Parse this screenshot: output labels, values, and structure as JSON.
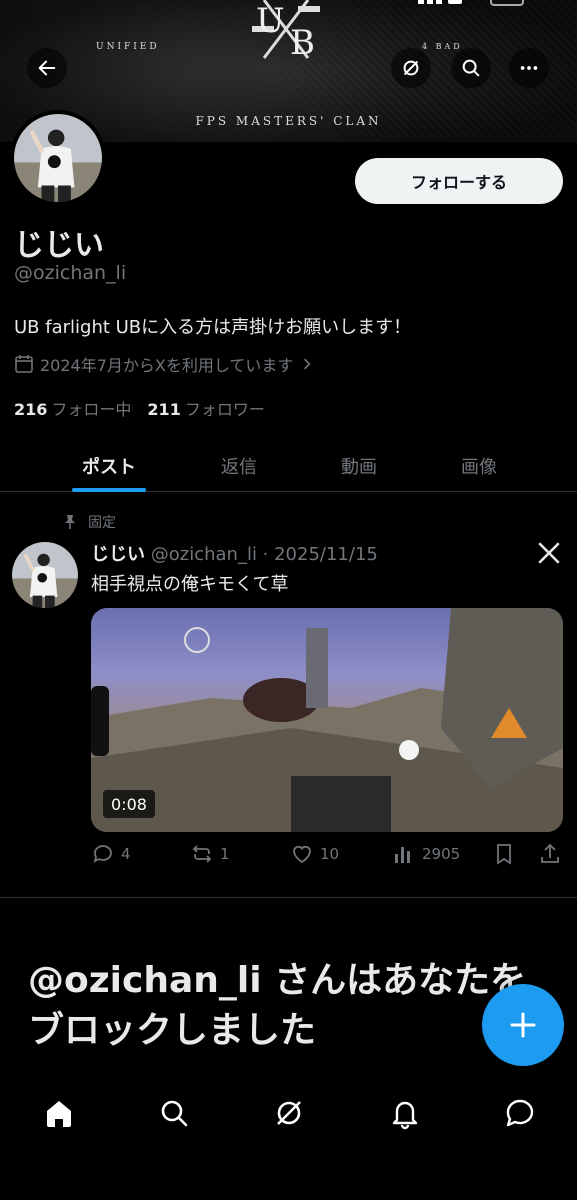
{
  "banner": {
    "unified": "UNIFIED",
    "four_bad": "4 BAD",
    "clan": "FPS MASTERS' CLAN",
    "logo_letters": "UB"
  },
  "header": {
    "back_icon": "arrow-left-icon",
    "grok_icon": "grok-icon",
    "search_icon": "search-icon",
    "more_icon": "more-icon"
  },
  "profile": {
    "name": "じじい",
    "handle": "@ozichan_li",
    "bio": "UB farlight UBに入る方は声掛けお願いします！",
    "joined": "2024年7月からXを利用しています",
    "follow_label": "フォローする",
    "following_count": "216",
    "following_label": "フォロー中",
    "followers_count": "211",
    "followers_label": "フォロワー"
  },
  "tabs": [
    {
      "label": "ポスト",
      "active": true
    },
    {
      "label": "返信",
      "active": false
    },
    {
      "label": "動画",
      "active": false
    },
    {
      "label": "画像",
      "active": false
    }
  ],
  "post": {
    "pinned_label": "固定",
    "author_name": "じじい",
    "author_meta": "@ozichan_li · 2025/11/15",
    "text": "相手視点の俺キモくて草",
    "video_duration": "0:08",
    "replies": "4",
    "reposts": "1",
    "likes": "10",
    "views": "2905"
  },
  "blocked": {
    "title": "@ozichan_li さんはあなたをブロックしました"
  },
  "colors": {
    "accent": "#1d9bf0",
    "background": "#000000",
    "text": "#e7e9ea",
    "muted": "#71767b"
  }
}
